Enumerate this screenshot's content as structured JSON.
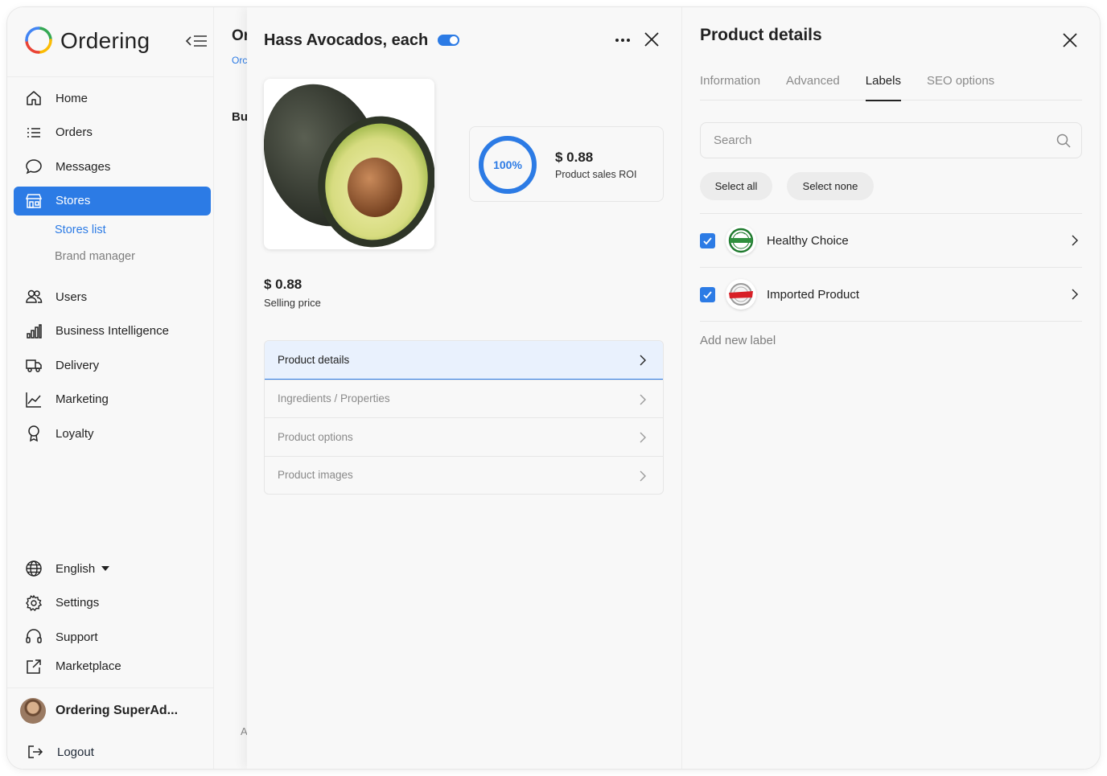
{
  "app": {
    "name": "Ordering"
  },
  "sidebar": {
    "items": [
      {
        "label": "Home",
        "icon": "home-icon"
      },
      {
        "label": "Orders",
        "icon": "list-icon"
      },
      {
        "label": "Messages",
        "icon": "message-icon"
      },
      {
        "label": "Stores",
        "icon": "store-icon",
        "active": true
      },
      {
        "label": "Users",
        "icon": "users-icon"
      },
      {
        "label": "Business Intelligence",
        "icon": "bar-chart-icon"
      },
      {
        "label": "Delivery",
        "icon": "truck-icon"
      },
      {
        "label": "Marketing",
        "icon": "line-chart-icon"
      },
      {
        "label": "Loyalty",
        "icon": "award-icon"
      }
    ],
    "subitems": [
      {
        "label": "Stores list",
        "active": true
      },
      {
        "label": "Brand manager"
      }
    ],
    "bottom": {
      "language": "English",
      "settings": "Settings",
      "support": "Support",
      "marketplace": "Marketplace"
    },
    "user": {
      "name": "Ordering SuperAd..."
    },
    "logout": "Logout"
  },
  "background_page": {
    "title": "Or",
    "breadcrumb": "Orc",
    "section": "Bu",
    "footer": "A"
  },
  "product": {
    "title": "Hass Avocados, each",
    "enabled": true,
    "roi": {
      "percent": "100%",
      "value": "$ 0.88",
      "label": "Product sales ROI"
    },
    "price": "$ 0.88",
    "price_label": "Selling price",
    "menu": [
      {
        "label": "Product details",
        "active": true
      },
      {
        "label": "Ingredients / Properties"
      },
      {
        "label": "Product options"
      },
      {
        "label": "Product images"
      }
    ]
  },
  "details": {
    "title": "Product details",
    "tabs": [
      {
        "label": "Information"
      },
      {
        "label": "Advanced"
      },
      {
        "label": "Labels",
        "active": true
      },
      {
        "label": "SEO options"
      }
    ],
    "search_placeholder": "Search",
    "select_all": "Select all",
    "select_none": "Select none",
    "labels": [
      {
        "name": "Healthy Choice",
        "checked": true
      },
      {
        "name": "Imported Product",
        "checked": true
      }
    ],
    "add_label": "Add new label"
  },
  "colors": {
    "accent": "#2c7be5",
    "background": "#f8f8f8"
  }
}
